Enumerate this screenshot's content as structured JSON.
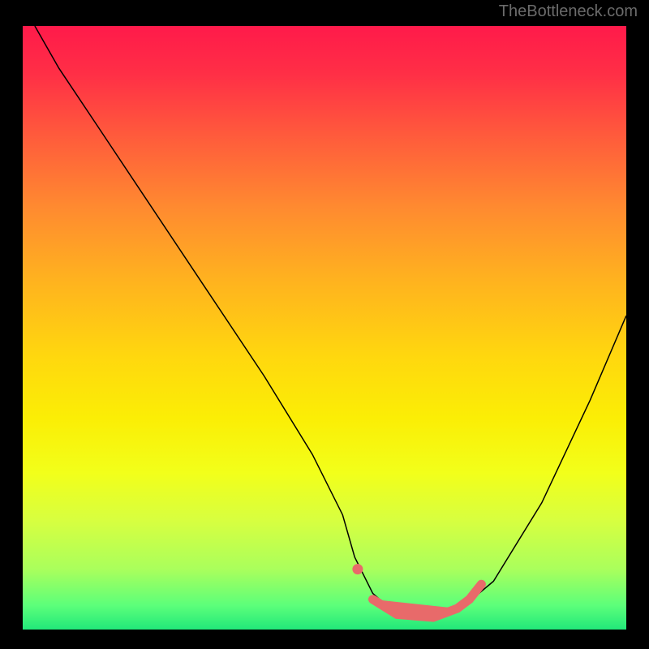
{
  "watermark": {
    "text": "TheBottleneck.com"
  },
  "chart_data": {
    "type": "line",
    "title": "",
    "xlabel": "",
    "ylabel": "",
    "xlim": [
      0,
      100
    ],
    "ylim": [
      0,
      100
    ],
    "grid": false,
    "axes_visible": false,
    "gradient": [
      "#ff1a4a",
      "#ff5a3c",
      "#ffb21f",
      "#fbee05",
      "#aaff5c",
      "#22e87a"
    ],
    "series": [
      {
        "name": "bottleneck-curve",
        "color": "#000000",
        "x": [
          2,
          6,
          12,
          20,
          30,
          40,
          48,
          53,
          55,
          58,
          62,
          68,
          72,
          78,
          86,
          94,
          100
        ],
        "y": [
          100,
          93,
          84,
          72,
          57,
          42,
          29,
          19,
          12,
          6,
          2.5,
          2,
          3,
          8,
          21,
          38,
          52
        ]
      }
    ],
    "highlight": {
      "color": "#e86a6a",
      "dot": {
        "x": 55.5,
        "y": 10
      },
      "segments": [
        {
          "x": [
            58,
            62,
            68,
            72
          ],
          "y": [
            5,
            2.5,
            2,
            3.5
          ]
        },
        {
          "x": [
            72,
            74,
            76
          ],
          "y": [
            3.5,
            5,
            7.5
          ]
        }
      ]
    }
  }
}
